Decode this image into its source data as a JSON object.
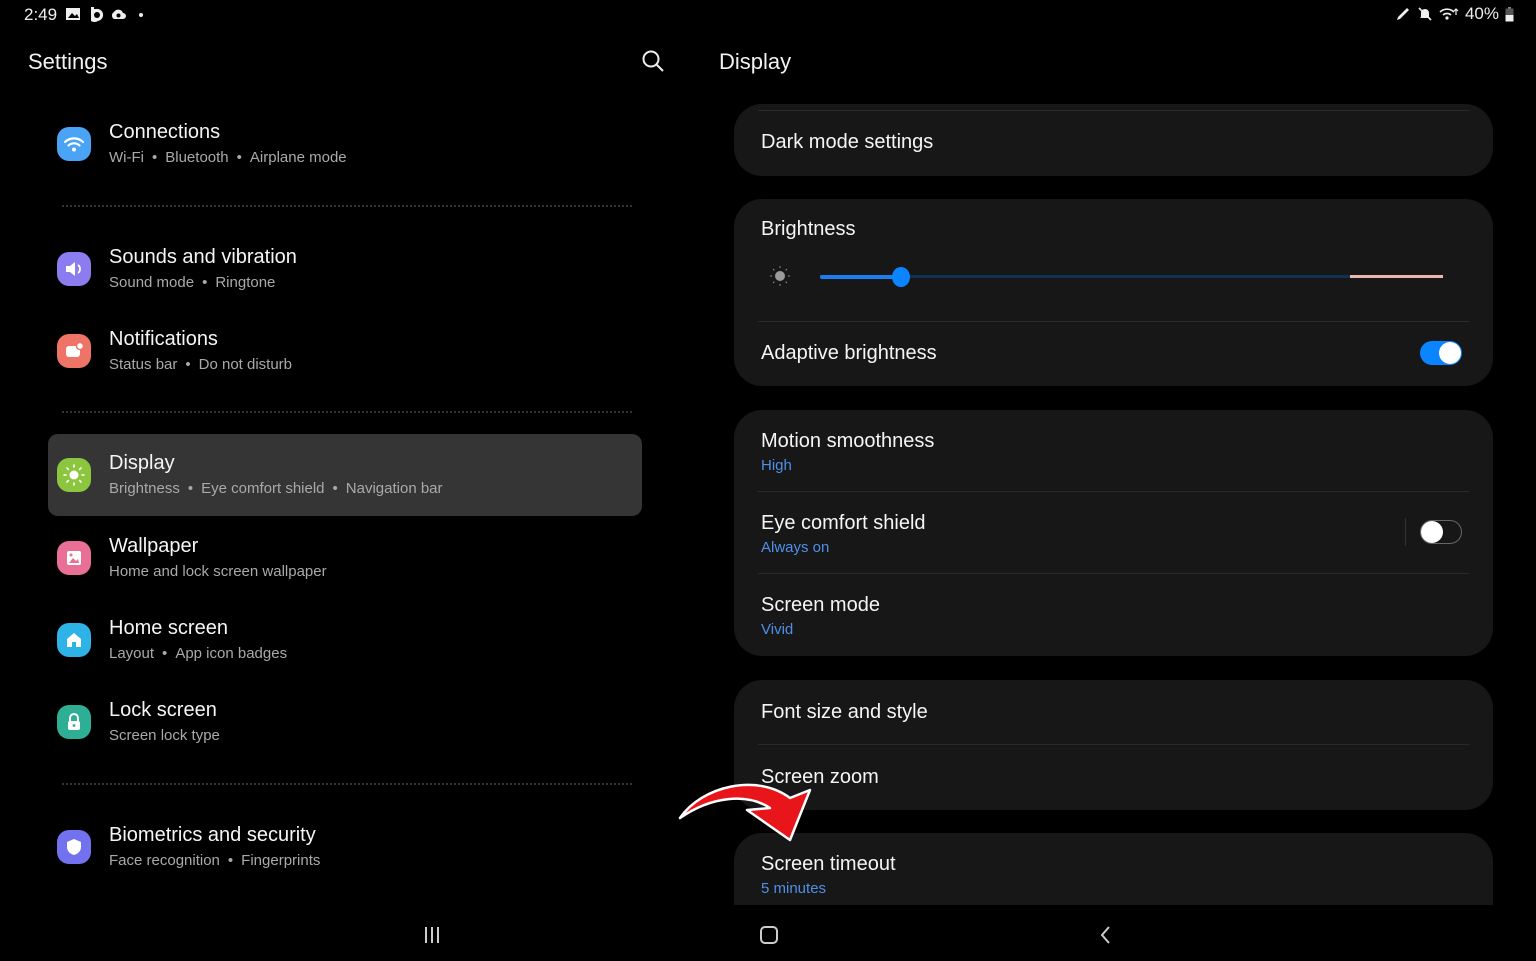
{
  "status_bar": {
    "time": "2:49",
    "left_icons": [
      "gallery-icon",
      "bixby-icon",
      "cloud-sync-icon",
      "dot-icon"
    ],
    "right_icons": [
      "pen-icon",
      "mute-icon",
      "wifi-icon"
    ],
    "battery": "40%"
  },
  "left_pane": {
    "title": "Settings",
    "search_icon": "search-icon",
    "items": [
      {
        "title": "Connections",
        "subtitle": [
          "Wi-Fi",
          "Bluetooth",
          "Airplane mode"
        ],
        "icon": "wifi-icon",
        "color": "#4aa3f5"
      },
      {
        "title": "Sounds and vibration",
        "subtitle": [
          "Sound mode",
          "Ringtone"
        ],
        "icon": "speaker-icon",
        "color": "#8b7cf0"
      },
      {
        "title": "Notifications",
        "subtitle": [
          "Status bar",
          "Do not disturb"
        ],
        "icon": "notification-icon",
        "color": "#ee7468"
      },
      {
        "title": "Display",
        "subtitle": [
          "Brightness",
          "Eye comfort shield",
          "Navigation bar"
        ],
        "icon": "sun-icon",
        "color": "#8cc63f",
        "selected": true
      },
      {
        "title": "Wallpaper",
        "subtitle": [
          "Home and lock screen wallpaper"
        ],
        "icon": "image-icon",
        "color": "#ea6f97"
      },
      {
        "title": "Home screen",
        "subtitle": [
          "Layout",
          "App icon badges"
        ],
        "icon": "home-icon",
        "color": "#2eb3e6"
      },
      {
        "title": "Lock screen",
        "subtitle": [
          "Screen lock type"
        ],
        "icon": "lock-icon",
        "color": "#2fae96"
      },
      {
        "title": "Biometrics and security",
        "subtitle": [
          "Face recognition",
          "Fingerprints"
        ],
        "icon": "shield-icon",
        "color": "#7272ee"
      }
    ]
  },
  "right_pane": {
    "title": "Display",
    "dark_mode": {
      "title": "Dark mode settings"
    },
    "brightness": {
      "title": "Brightness",
      "value_percent": 13,
      "warn_from_percent": 85
    },
    "adaptive_brightness": {
      "title": "Adaptive brightness",
      "enabled": true
    },
    "motion_smoothness": {
      "title": "Motion smoothness",
      "value": "High"
    },
    "eye_comfort": {
      "title": "Eye comfort shield",
      "value": "Always on",
      "enabled": false
    },
    "screen_mode": {
      "title": "Screen mode",
      "value": "Vivid"
    },
    "font_size": {
      "title": "Font size and style"
    },
    "screen_zoom": {
      "title": "Screen zoom"
    },
    "screen_timeout": {
      "title": "Screen timeout",
      "value": "5 minutes"
    }
  },
  "nav_bar": {
    "recents": "recents-icon",
    "home": "home-button-icon",
    "back": "back-icon"
  },
  "colors": {
    "accent": "#0a84ff",
    "sub_value": "#4f8fe8",
    "card": "#171717",
    "selected": "#353535",
    "annotation": "#e8161b"
  }
}
